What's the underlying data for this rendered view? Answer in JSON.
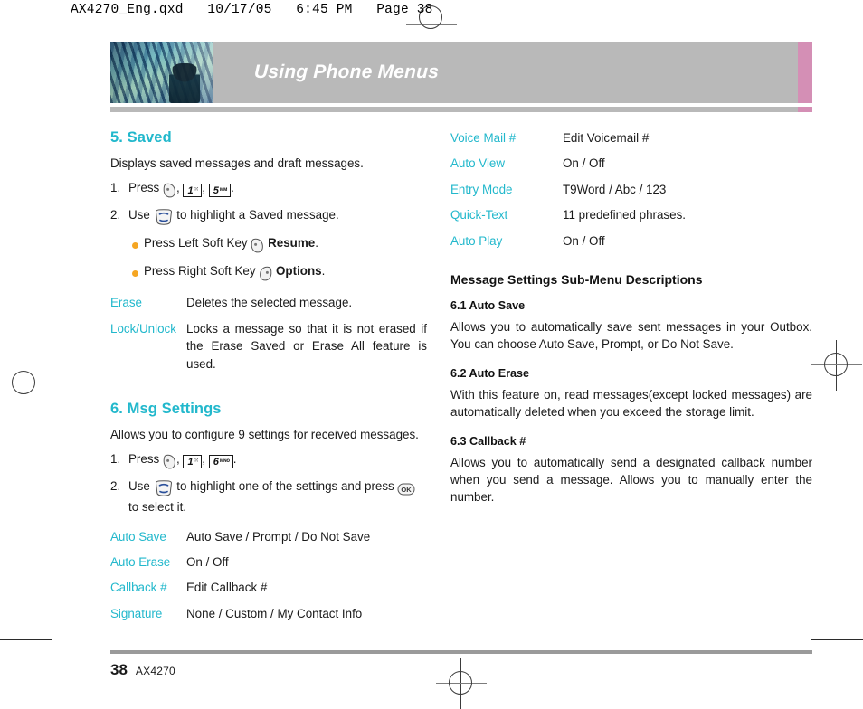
{
  "file_header": "AX4270_Eng.qxd   10/17/05   6:45 PM   Page 38",
  "banner": {
    "title": "Using Phone Menus",
    "accent_color": "#d48fb5",
    "bar_color": "#b9b9b9",
    "photo_alt": "abstract-blue-architecture-photo"
  },
  "theme": {
    "heading_teal": "#22b8cc",
    "bullet_orange": "#f5a623",
    "body_text": "#1a1a1a"
  },
  "left_column": {
    "section_saved": {
      "title": "5. Saved",
      "intro": "Displays saved messages and draft messages.",
      "steps": [
        {
          "num": "1.",
          "pre": "Press",
          "keys": [
            "soft-left-key",
            "key-1",
            "key-5"
          ],
          "key_labels": [
            "",
            "1",
            "5"
          ],
          "key_sups": [
            "",
            "⁙",
            "ᴍᴍ"
          ],
          "post": "."
        },
        {
          "num": "2.",
          "pre": "Use",
          "keys": [
            "navigation-key"
          ],
          "post": "to highlight a Saved message."
        }
      ],
      "bullets": [
        {
          "pre": "Press Left Soft Key",
          "icon": "soft-left-key",
          "bold": "Resume",
          "post": "."
        },
        {
          "pre": "Press Right Soft Key",
          "icon": "soft-right-key",
          "bold": "Options",
          "post": "."
        }
      ],
      "definitions": [
        {
          "term": "Erase",
          "desc": "Deletes the selected message."
        },
        {
          "term": "Lock/Unlock",
          "desc": "Locks a message so that it is not erased if the Erase Saved or Erase All feature is used."
        }
      ]
    },
    "section_msg_settings": {
      "title": "6. Msg Settings",
      "intro": "Allows you to configure 9 settings for received messages.",
      "step1": {
        "num": "1.",
        "pre": "Press",
        "key_labels": [
          "1",
          "6"
        ],
        "key_sups": [
          "⁙",
          "ᴍɴᴏ"
        ],
        "post": "."
      },
      "step2": {
        "num": "2.",
        "pre": "Use",
        "mid": "to highlight one of the settings and press",
        "ok_label": "OK",
        "post": "to select it."
      },
      "definitions": [
        {
          "term": "Auto Save",
          "desc": "Auto Save / Prompt / Do Not Save"
        },
        {
          "term": "Auto Erase",
          "desc": "On / Off"
        },
        {
          "term": "Callback #",
          "desc": "Edit Callback #"
        },
        {
          "term": "Signature",
          "desc": "None / Custom / My Contact Info"
        }
      ]
    }
  },
  "right_column": {
    "settings": [
      {
        "term": "Voice Mail #",
        "desc": "Edit Voicemail #"
      },
      {
        "term": "Auto View",
        "desc": "On / Off"
      },
      {
        "term": "Entry Mode",
        "desc": "T9Word / Abc / 123"
      },
      {
        "term": "Quick-Text",
        "desc": "11 predefined phrases."
      },
      {
        "term": "Auto Play",
        "desc": "On / Off"
      }
    ],
    "sub_menu_heading": "Message Settings Sub-Menu Descriptions",
    "blocks": [
      {
        "heading": "6.1 Auto Save",
        "text": "Allows you to automatically save sent messages in your Outbox. You can choose Auto Save, Prompt, or Do Not Save."
      },
      {
        "heading": "6.2 Auto Erase",
        "text": "With this feature on, read messages(except locked messages) are automatically deleted when you exceed the storage limit."
      },
      {
        "heading": "6.3 Callback #",
        "text": "Allows you to automatically send a designated callback number when you send a message. Allows you to manually enter the number."
      }
    ]
  },
  "footer": {
    "page_number": "38",
    "model": "AX4270"
  }
}
